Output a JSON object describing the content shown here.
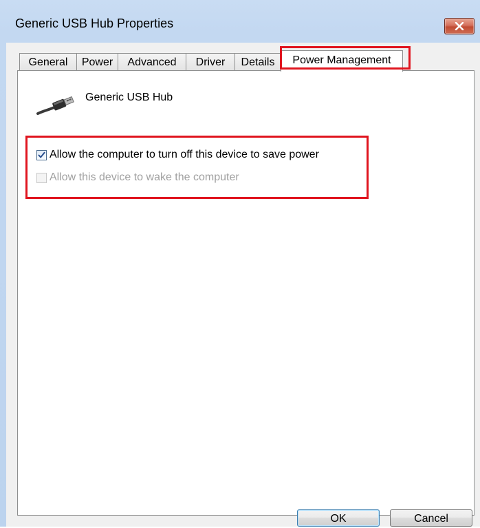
{
  "window": {
    "title": "Generic USB Hub Properties"
  },
  "tabs": [
    {
      "label": "General",
      "active": false
    },
    {
      "label": "Power",
      "active": false
    },
    {
      "label": "Advanced",
      "active": false
    },
    {
      "label": "Driver",
      "active": false
    },
    {
      "label": "Details",
      "active": false
    },
    {
      "label": "Power Management",
      "active": true
    }
  ],
  "device": {
    "name": "Generic USB Hub",
    "icon": "usb-cable-icon"
  },
  "options": [
    {
      "label": "Allow the computer to turn off this device to save power",
      "checked": true,
      "enabled": true
    },
    {
      "label": "Allow this device to wake the computer",
      "checked": false,
      "enabled": false
    }
  ],
  "buttons": {
    "ok": "OK",
    "cancel": "Cancel"
  },
  "colors": {
    "highlight": "#e0141e",
    "close_button": "#c14b32",
    "frame": "#bcd3ee"
  }
}
